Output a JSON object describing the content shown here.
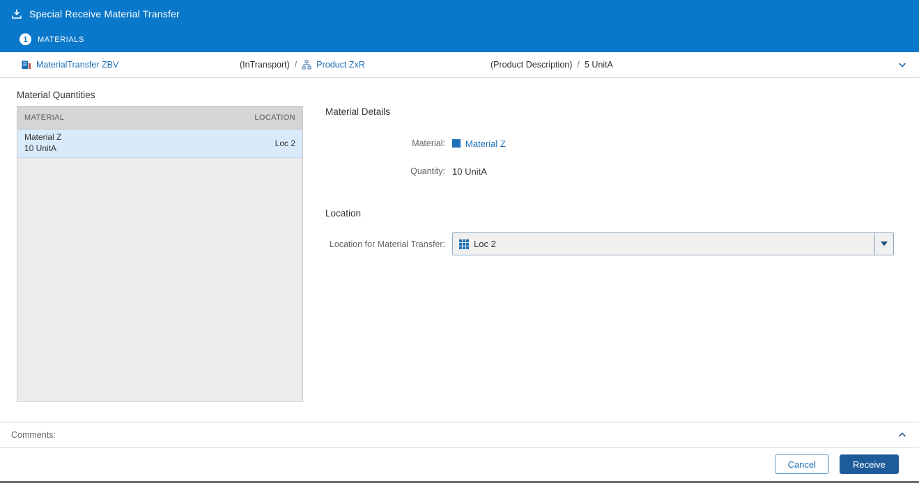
{
  "header": {
    "title": "Special Receive Material Transfer",
    "step_number": "1",
    "step_label": "MATERIALS"
  },
  "breadcrumb": {
    "transfer_link": "MaterialTransfer ZBV",
    "transfer_status": "(InTransport)",
    "separator": "/",
    "product_link": "Product ZxR",
    "product_description": "(Product Description)",
    "product_quantity": "5 UnitA"
  },
  "material_quantities": {
    "title": "Material Quantities",
    "columns": [
      "MATERIAL",
      "LOCATION"
    ],
    "rows": [
      {
        "material": "Material Z",
        "quantity": "10 UnitA",
        "location": "Loc 2"
      }
    ]
  },
  "material_details": {
    "title": "Material Details",
    "material_label": "Material:",
    "material_value": "Material Z",
    "quantity_label": "Quantity:",
    "quantity_value": "10 UnitA"
  },
  "location": {
    "title": "Location",
    "label": "Location for Material Transfer:",
    "selected_value": "Loc 2"
  },
  "comments": {
    "label": "Comments:"
  },
  "footer": {
    "cancel_label": "Cancel",
    "receive_label": "Receive"
  },
  "colors": {
    "header_blue": "#0a78ca",
    "link_blue": "#1d6fb8",
    "selected_row": "#d9eafa",
    "receive_button_blue": "#1d5c99"
  }
}
